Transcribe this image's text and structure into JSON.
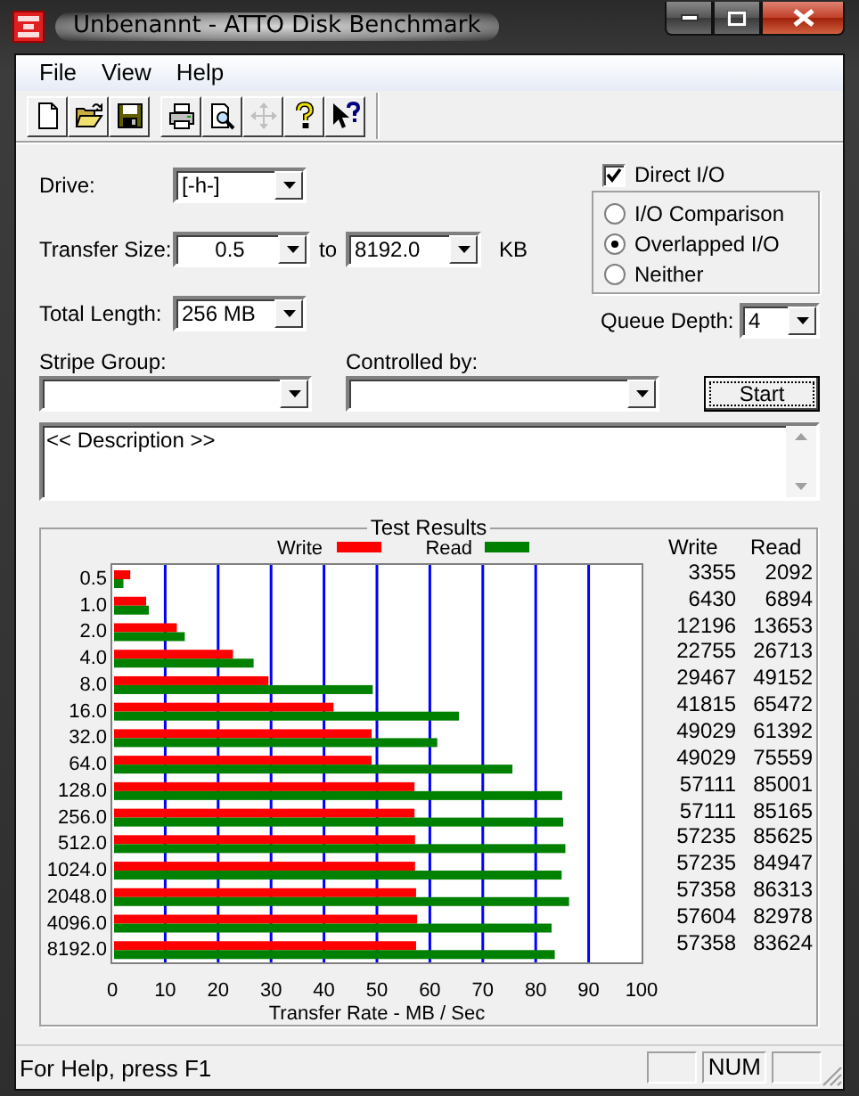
{
  "window": {
    "title": "Unbenannt - ATTO Disk Benchmark"
  },
  "menu": [
    {
      "label": "File"
    },
    {
      "label": "View"
    },
    {
      "label": "Help"
    }
  ],
  "toolbar": [
    {
      "kind": "new",
      "disabled": false
    },
    {
      "kind": "open",
      "disabled": false
    },
    {
      "kind": "save",
      "disabled": false
    },
    {
      "kind": "print",
      "disabled": false
    },
    {
      "kind": "preview",
      "disabled": false
    },
    {
      "kind": "move",
      "disabled": true
    },
    {
      "kind": "help",
      "disabled": false
    },
    {
      "kind": "context-help",
      "disabled": false
    }
  ],
  "settings": {
    "drive": {
      "label": "Drive:",
      "value": "[-h-]"
    },
    "transfer_size": {
      "label": "Transfer Size:",
      "from": "0.5",
      "to_label": "to",
      "to": "8192.0",
      "unit": "KB"
    },
    "total_length": {
      "label": "Total Length:",
      "value": "256 MB"
    },
    "direct_io": {
      "label": "Direct I/O",
      "checked": true
    },
    "io_modes": [
      {
        "label": "I/O Comparison",
        "selected": false
      },
      {
        "label": "Overlapped I/O",
        "selected": true
      },
      {
        "label": "Neither",
        "selected": false
      }
    ],
    "queue_depth": {
      "label": "Queue Depth:",
      "value": "4"
    },
    "stripe_group": {
      "label": "Stripe Group:"
    },
    "controlled_by": {
      "label": "Controlled by:"
    },
    "start_button": "Start",
    "description": "<< Description >>"
  },
  "test_results": {
    "title": "Test Results",
    "chart_data": {
      "type": "bar",
      "orientation": "horizontal",
      "xlabel": "Transfer Rate - MB / Sec",
      "categories": [
        "0.5",
        "1.0",
        "2.0",
        "4.0",
        "8.0",
        "16.0",
        "32.0",
        "64.0",
        "128.0",
        "256.0",
        "512.0",
        "1024.0",
        "2048.0",
        "4096.0",
        "8192.0"
      ],
      "series": [
        {
          "name": "Write",
          "color": "#ff0000",
          "values": [
            3.4,
            6.4,
            12.2,
            22.8,
            29.5,
            41.8,
            49.0,
            49.0,
            57.1,
            57.1,
            57.2,
            57.2,
            57.4,
            57.6,
            57.4
          ]
        },
        {
          "name": "Read",
          "color": "#008000",
          "values": [
            2.1,
            6.9,
            13.7,
            26.7,
            49.2,
            65.5,
            61.4,
            75.6,
            85.0,
            85.2,
            85.6,
            84.9,
            86.3,
            83.0,
            83.6
          ]
        }
      ],
      "grid": true,
      "legend": true,
      "xlim": [
        0,
        100
      ],
      "xticks": [
        0,
        10,
        20,
        30,
        40,
        50,
        60,
        70,
        80,
        90,
        100
      ]
    },
    "table": {
      "columns": [
        "Write",
        "Read"
      ],
      "rows": [
        [
          "3355",
          "2092"
        ],
        [
          "6430",
          "6894"
        ],
        [
          "12196",
          "13653"
        ],
        [
          "22755",
          "26713"
        ],
        [
          "29467",
          "49152"
        ],
        [
          "41815",
          "65472"
        ],
        [
          "49029",
          "61392"
        ],
        [
          "49029",
          "75559"
        ],
        [
          "57111",
          "85001"
        ],
        [
          "57111",
          "85165"
        ],
        [
          "57235",
          "85625"
        ],
        [
          "57235",
          "84947"
        ],
        [
          "57358",
          "86313"
        ],
        [
          "57604",
          "82978"
        ],
        [
          "57358",
          "83624"
        ]
      ]
    }
  },
  "status_bar": {
    "text": "For Help, press F1",
    "indicators": [
      "NUM"
    ]
  }
}
